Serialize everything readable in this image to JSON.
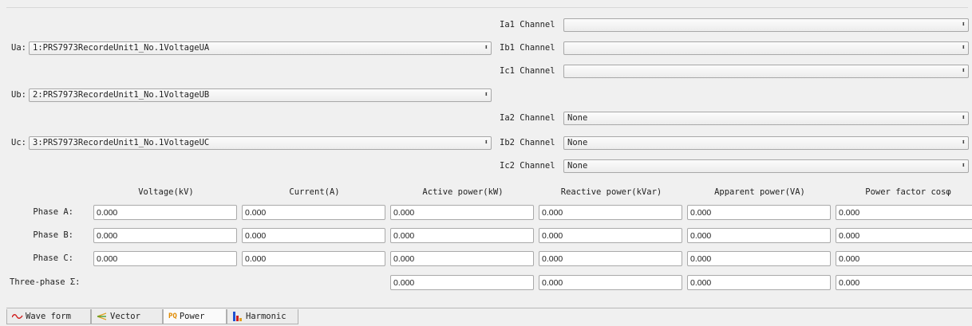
{
  "channels": {
    "ua": {
      "label": "Ua:",
      "value": "1:PRS7973RecordeUnit1_No.1VoltageUA"
    },
    "ub": {
      "label": "Ub:",
      "value": "2:PRS7973RecordeUnit1_No.1VoltageUB"
    },
    "uc": {
      "label": "Uc:",
      "value": "3:PRS7973RecordeUnit1_No.1VoltageUC"
    },
    "ia1": {
      "label": "Ia1 Channel",
      "value": ""
    },
    "ib1": {
      "label": "Ib1 Channel",
      "value": ""
    },
    "ic1": {
      "label": "Ic1 Channel",
      "value": ""
    },
    "add_button": "+",
    "ia2": {
      "label": "Ia2 Channel",
      "value": "None"
    },
    "ib2": {
      "label": "Ib2 Channel",
      "value": "None"
    },
    "ic2": {
      "label": "Ic2 Channel",
      "value": "None"
    }
  },
  "table": {
    "headers": [
      "Voltage(kV)",
      "Current(A)",
      "Active power(kW)",
      "Reactive power(kVar)",
      "Apparent power(VA)",
      "Power factor cosφ"
    ],
    "rows": [
      {
        "label": "Phase A:",
        "values": [
          "0.000",
          "0.000",
          "0.000",
          "0.000",
          "0.000",
          "0.000"
        ]
      },
      {
        "label": "Phase B:",
        "values": [
          "0.000",
          "0.000",
          "0.000",
          "0.000",
          "0.000",
          "0.000"
        ]
      },
      {
        "label": "Phase C:",
        "values": [
          "0.000",
          "0.000",
          "0.000",
          "0.000",
          "0.000",
          "0.000"
        ]
      }
    ],
    "total": {
      "label": "Three-phase Σ:",
      "values": [
        "0.000",
        "0.000",
        "0.000",
        "0.000"
      ]
    }
  },
  "tabs": [
    {
      "label": "Wave form",
      "icon": "wave-icon"
    },
    {
      "label": "Vector",
      "icon": "vector-icon"
    },
    {
      "label": "Power",
      "icon": "power-icon",
      "active": true
    },
    {
      "label": "Harmonic",
      "icon": "harmonic-icon"
    }
  ]
}
